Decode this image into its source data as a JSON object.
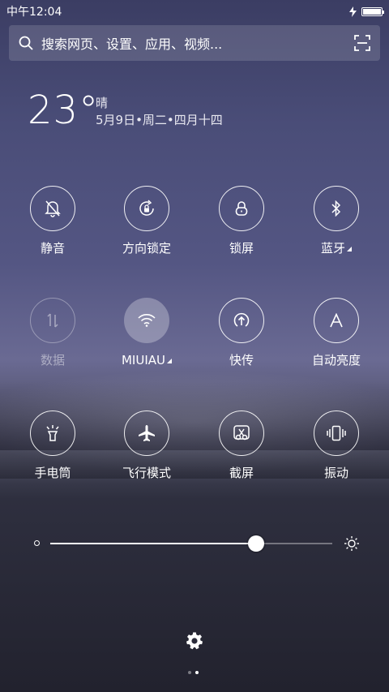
{
  "status_bar": {
    "time": "中午12:04",
    "battery_level": 1.0
  },
  "search": {
    "placeholder": "搜索网页、设置、应用、视频..."
  },
  "weather": {
    "temperature": "23°",
    "condition": "晴",
    "date": "5月9日•周二•四月十四"
  },
  "toggles": [
    {
      "label": "静音",
      "icon": "bell-off-icon",
      "state": "off"
    },
    {
      "label": "方向锁定",
      "icon": "rotation-lock-icon",
      "state": "off"
    },
    {
      "label": "锁屏",
      "icon": "lock-icon",
      "state": "off"
    },
    {
      "label": "蓝牙",
      "icon": "bluetooth-icon",
      "state": "off"
    },
    {
      "label": "数据",
      "icon": "data-arrows-icon",
      "state": "disabled"
    },
    {
      "label": "MIUIAU",
      "icon": "wifi-icon",
      "state": "on"
    },
    {
      "label": "快传",
      "icon": "share-upload-icon",
      "state": "off"
    },
    {
      "label": "自动亮度",
      "icon": "auto-brightness-icon",
      "state": "off"
    },
    {
      "label": "手电筒",
      "icon": "flashlight-icon",
      "state": "off"
    },
    {
      "label": "飞行模式",
      "icon": "airplane-icon",
      "state": "off"
    },
    {
      "label": "截屏",
      "icon": "screenshot-scissors-icon",
      "state": "off"
    },
    {
      "label": "振动",
      "icon": "vibrate-icon",
      "state": "off"
    }
  ],
  "brightness": {
    "level": 0.73
  },
  "pager": {
    "pages": 2,
    "active": 2
  }
}
